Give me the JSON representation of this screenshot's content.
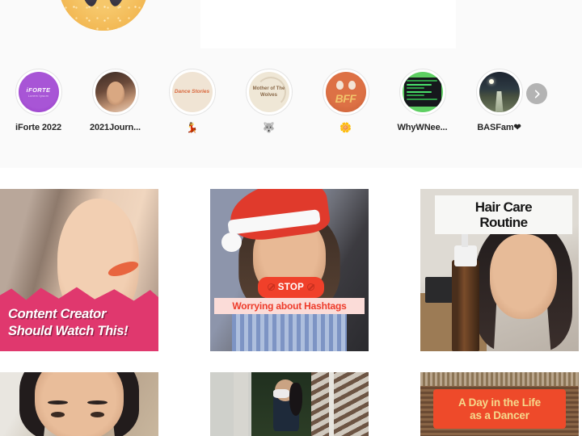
{
  "profile": {
    "avatar_alt": "profile-avatar"
  },
  "highlights": [
    {
      "label": "iForte 2022",
      "cover": "iforte",
      "cover_title": "iFORTE",
      "cover_sub": "Lorem Ipsum"
    },
    {
      "label": "2021Journ...",
      "cover": "photo1",
      "cover_title": "",
      "cover_sub": ""
    },
    {
      "label": "💃",
      "cover": "dance",
      "cover_title": "Dance Stories",
      "cover_sub": ""
    },
    {
      "label": "🐺",
      "cover": "wolves",
      "cover_title": "Mother of The Wolves",
      "cover_sub": ""
    },
    {
      "label": "🌼",
      "cover": "bff",
      "cover_title": "BFF",
      "cover_sub": ""
    },
    {
      "label": "WhyWNee...",
      "cover": "green",
      "cover_title": "",
      "cover_sub": ""
    },
    {
      "label": "BASFam❤",
      "cover": "night",
      "cover_title": "",
      "cover_sub": ""
    }
  ],
  "next_button": {
    "name": "next-highlights"
  },
  "posts": [
    {
      "id": "post-1",
      "overlay_text": "Content Creator\nShould Watch This!",
      "overlay_line1": "Content Creator",
      "overlay_line2": "Should Watch This!"
    },
    {
      "id": "post-2",
      "badge_text": "STOP",
      "overlay_text": "Worrying about Hashtags"
    },
    {
      "id": "post-3",
      "overlay_line1": "Hair Care",
      "overlay_line2": "Routine"
    },
    {
      "id": "post-4",
      "overlay_text": ""
    },
    {
      "id": "post-5",
      "overlay_text": ""
    },
    {
      "id": "post-6",
      "overlay_line1": "A Day in the Life",
      "overlay_line2": "as a Dancer"
    }
  ],
  "colors": {
    "page_bg": "#ffffff",
    "profile_bg": "#fafafa",
    "text": "#262626",
    "accent_red": "#f0402a",
    "accent_pink": "#e0386e",
    "highlight_purple": "#9333c4",
    "badge_cream": "#f5d98c"
  }
}
